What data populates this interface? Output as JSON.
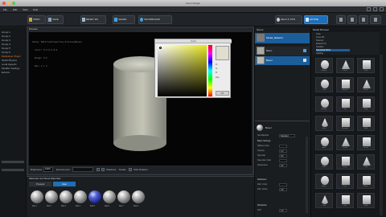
{
  "window": {
    "title": "Zoom Design"
  },
  "menu": [
    "File",
    "Edit",
    "View",
    "Help"
  ],
  "toolbar": {
    "buttons": [
      "OPEN",
      "SAVE",
      "RESET RS",
      "SHARE",
      "SNOWBOARD"
    ],
    "help": "HELP & TIPS",
    "active": "ACTIVE",
    "accent": "#1f6fb8"
  },
  "tree": {
    "items": [
      "Group 1",
      "Group 2",
      "Group 3",
      "Group 4",
      "Group 5",
      "Group 6",
      "Multiplayer Plugin",
      "World Physics",
      "Local Aspects",
      "Modifier Settings",
      "Exterior"
    ],
    "selected_index": 6
  },
  "viewport": {
    "title": "Preview",
    "code": [
      "Setup: MaterialProperties_Preview(Bevel)",
      "  Color: 0.9 0.9 0.6",
      "  Rough: 0.5",
      "  Res: 2 x 3"
    ],
    "bottom": {
      "brightness_label": "Brightness",
      "brightness_value": "100%",
      "environment_label": "Environment",
      "shadows_label": "Shadows",
      "rotate_label": "Rotate",
      "cursor_label": "Shift Rotation"
    }
  },
  "picker": {
    "title": "Color",
    "fields": [
      "R:",
      "G:",
      "B:",
      "Hex:"
    ],
    "ok": "OK"
  },
  "materials": {
    "title": "Materials and Mood Materials",
    "tabs": [
      "Presets",
      "User"
    ],
    "items": [
      "Mat 1",
      "Mat 2",
      "Mat 3",
      "Mat 4",
      "Mat 5",
      "Mat 6",
      "Mat 7",
      "Mat 8"
    ],
    "selected_index": 4
  },
  "scene": {
    "title": "Scene",
    "rows": [
      {
        "name": "Model_Material"
      },
      {
        "name": "Basic"
      },
      {
        "name": "Bevel"
      }
    ],
    "prop_title": "Bevel",
    "props": [
      {
        "label": "Set Material",
        "value": "Standard"
      },
      {
        "label": "Basic Settings",
        "value": ""
      },
      {
        "label": "Diffuse Color",
        "value": ""
      },
      {
        "label": "Opacity",
        "value": "1.0"
      },
      {
        "label": "Specular",
        "value": "0.5"
      },
      {
        "label": "Specular Color",
        "value": ""
      },
      {
        "label": "Glossiness",
        "value": "0.3"
      },
      {
        "label": "Reflection",
        "value": ""
      },
      {
        "label": "Refl. Color",
        "value": ""
      },
      {
        "label": "Refl. Gloss",
        "value": "0.8"
      },
      {
        "label": "Refraction",
        "value": ""
      },
      {
        "label": "IOR",
        "value": "1.5"
      }
    ]
  },
  "library": {
    "title": "Model Browser",
    "items": [
      "Core",
      "Lines 3D",
      "Scenery",
      "Exterior Kit",
      "Outdoor",
      "Structural Parts",
      "Lighting"
    ],
    "selected_index": 5,
    "cells": [
      "Sphere",
      "Cone",
      "Cube",
      "Tube",
      "Cylinder",
      "Prism",
      "Wedge",
      "Box",
      "Ring",
      "Torus",
      "Pyramid",
      "Slab",
      "Arch",
      "Frame",
      "Panel",
      "Pillar",
      "Dome",
      "Plate",
      "Block",
      "Post",
      "Base",
      "Cap",
      "Cell",
      "Rod"
    ]
  }
}
